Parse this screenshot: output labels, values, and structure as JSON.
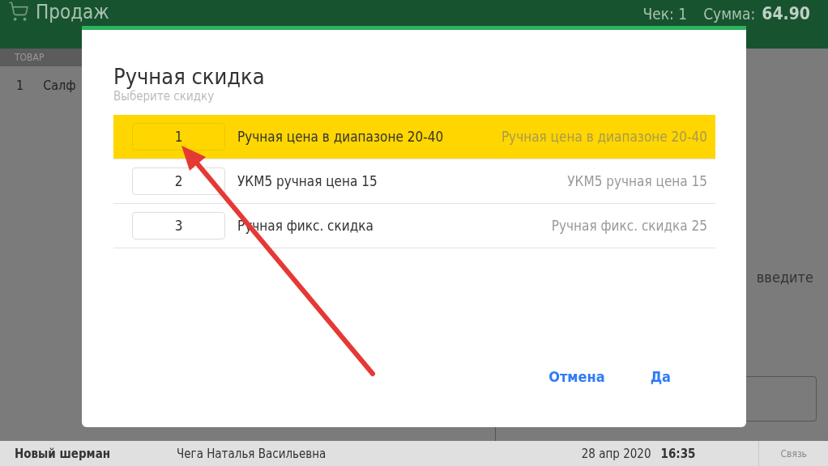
{
  "header": {
    "title": "Продаж",
    "check": "Чек: 1",
    "sum_label": "Сумма:",
    "sum": "64.90"
  },
  "table": {
    "columns": [
      "ТОВАР"
    ],
    "rows": [
      {
        "index": "1",
        "name": "Салф"
      }
    ]
  },
  "right_panel": {
    "prompt": "введите"
  },
  "dialog": {
    "title": "Ручная скидка",
    "subtitle": "Выберите скидку",
    "options": [
      {
        "number": "1",
        "label": "Ручная цена в диапазоне 20-40",
        "description": "Ручная цена в диапазоне 20-40",
        "selected": true
      },
      {
        "number": "2",
        "label": "УКМ5 ручная цена 15",
        "description": "УКМ5 ручная цена 15",
        "selected": false
      },
      {
        "number": "3",
        "label": "Ручная фикс. скидка",
        "description": "Ручная фикс. скидка 25",
        "selected": false
      }
    ],
    "buttons": [
      "Отмена",
      "Да"
    ]
  },
  "status_bar": {
    "shop": "Новый шерман",
    "cashier": "Чега Наталья Васильевна",
    "date": "28 апр 2020",
    "time": "16:35",
    "link": "Связь"
  }
}
